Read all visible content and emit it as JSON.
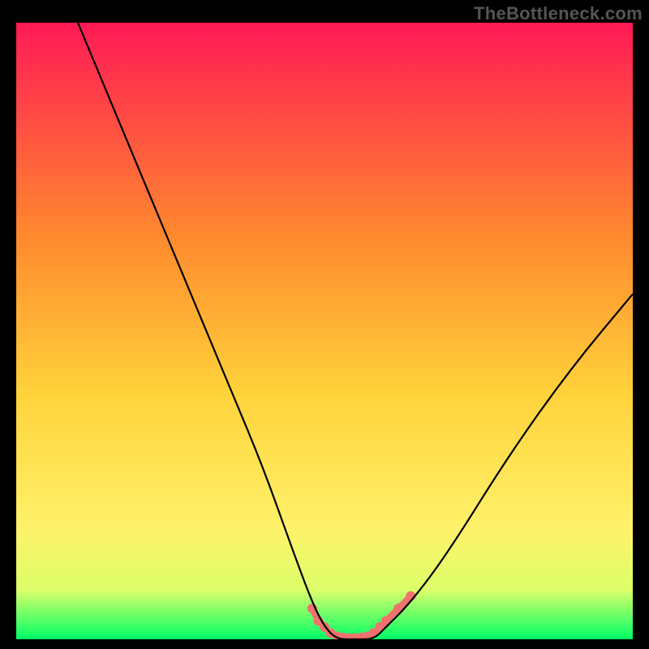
{
  "watermark": "TheBottleneck.com",
  "chart_data": {
    "type": "line",
    "title": "",
    "xlabel": "",
    "ylabel": "",
    "xlim": [
      0,
      100
    ],
    "ylim": [
      0,
      100
    ],
    "background_gradient": [
      "#ff1a55",
      "#ffb22e",
      "#ffe85a",
      "#e8ff6a",
      "#00ff66"
    ],
    "series": [
      {
        "name": "curve",
        "color": "#000000",
        "x": [
          10,
          15,
          20,
          25,
          30,
          35,
          40,
          45,
          48,
          50,
          52,
          55,
          58,
          60,
          64,
          70,
          80,
          90,
          100
        ],
        "y": [
          100,
          88,
          76,
          64,
          52,
          40,
          28,
          14,
          6,
          2,
          0,
          0,
          0,
          2,
          6,
          14,
          30,
          44,
          56
        ]
      },
      {
        "name": "highlight",
        "color": "#f0726f",
        "x": [
          48,
          49,
          50,
          51,
          52,
          53,
          54,
          55,
          56,
          57,
          58,
          59,
          60,
          62,
          64
        ],
        "y": [
          5,
          3,
          2,
          1,
          0.5,
          0.3,
          0.2,
          0.2,
          0.3,
          0.5,
          1,
          2,
          3,
          5,
          7
        ]
      }
    ]
  }
}
